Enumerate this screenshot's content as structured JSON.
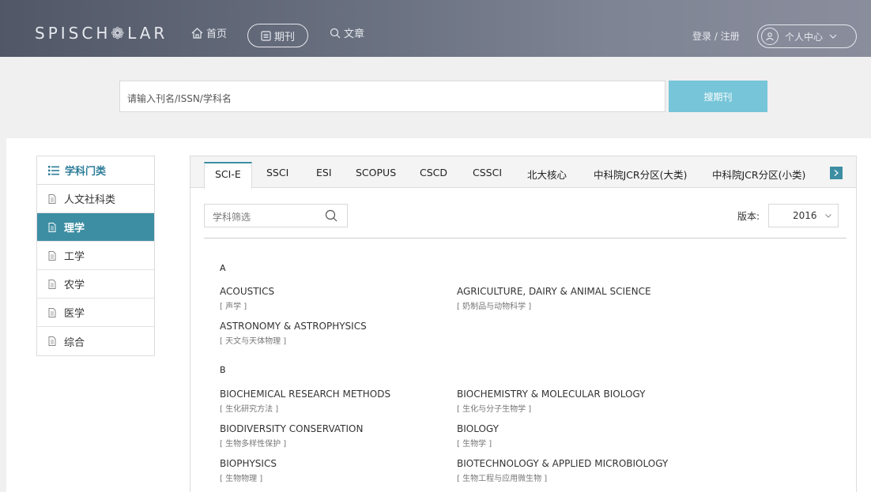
{
  "header": {
    "logo_text": "SPISCH",
    "logo_tail": "LAR",
    "nav_home": "首页",
    "nav_journal": "期刊",
    "nav_article": "文章",
    "login": "登录 / 注册",
    "user_center": "个人中心"
  },
  "search": {
    "placeholder": "请输入刊名/ISSN/学科名",
    "button": "搜期刊"
  },
  "sidebar": {
    "title": "学科门类",
    "items": [
      {
        "label": "人文社科类"
      },
      {
        "label": "理学",
        "active": true
      },
      {
        "label": "工学"
      },
      {
        "label": "农学"
      },
      {
        "label": "医学"
      },
      {
        "label": "综合"
      }
    ]
  },
  "tabs": [
    {
      "label": "SCI-E",
      "active": true
    },
    {
      "label": "SSCI"
    },
    {
      "label": "ESI"
    },
    {
      "label": "SCOPUS"
    },
    {
      "label": "CSCD"
    },
    {
      "label": "CSSCI"
    },
    {
      "label": "北大核心"
    },
    {
      "label": "中科院JCR分区(大类)"
    },
    {
      "label": "中科院JCR分区(小类)"
    }
  ],
  "filter": {
    "placeholder": "学科筛选",
    "version_label": "版本:",
    "version_value": "2016"
  },
  "groups": [
    {
      "letter": "A",
      "subjects": [
        {
          "en": "ACOUSTICS",
          "cn": "[ 声学 ]"
        },
        {
          "en": "AGRICULTURE, DAIRY & ANIMAL SCIENCE",
          "cn": "[ 奶制品与动物科学 ]"
        },
        {
          "en": "ASTRONOMY & ASTROPHYSICS",
          "cn": "[ 天文与天体物理 ]"
        }
      ]
    },
    {
      "letter": "B",
      "subjects": [
        {
          "en": "BIOCHEMICAL RESEARCH METHODS",
          "cn": "[ 生化研究方法 ]"
        },
        {
          "en": "BIOCHEMISTRY & MOLECULAR BIOLOGY",
          "cn": "[ 生化与分子生物学 ]"
        },
        {
          "en": "BIODIVERSITY CONSERVATION",
          "cn": "[ 生物多样性保护 ]"
        },
        {
          "en": "BIOLOGY",
          "cn": "[ 生物学 ]"
        },
        {
          "en": "BIOPHYSICS",
          "cn": "[ 生物物理 ]"
        },
        {
          "en": "BIOTECHNOLOGY & APPLIED MICROBIOLOGY",
          "cn": "[ 生物工程与应用微生物 ]"
        }
      ]
    }
  ]
}
